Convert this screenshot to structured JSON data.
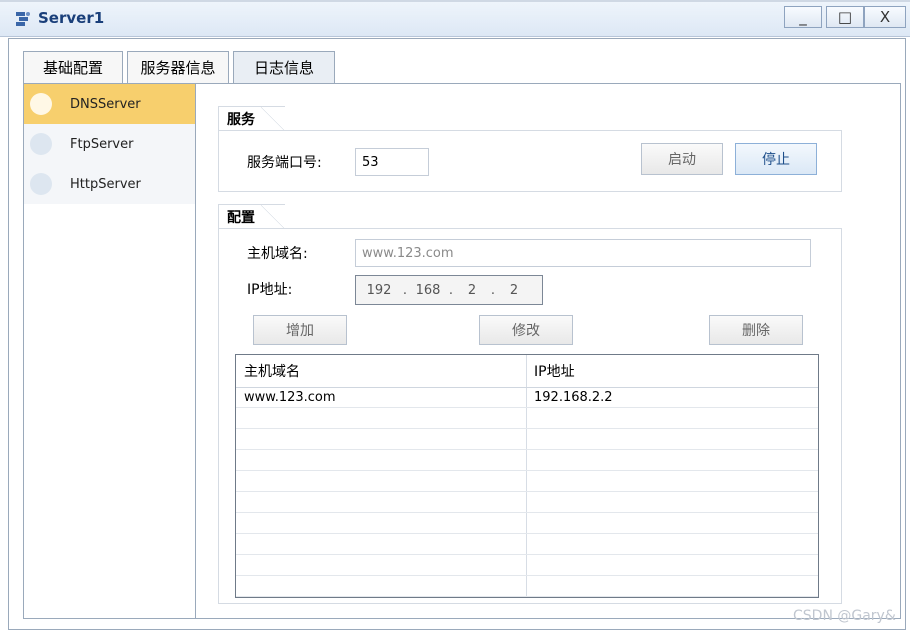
{
  "window": {
    "title": "Server1",
    "min_symbol": "_",
    "max_symbol": "□",
    "close_symbol": "X"
  },
  "tabs": [
    {
      "label": "基础配置"
    },
    {
      "label": "服务器信息"
    },
    {
      "label": "日志信息"
    }
  ],
  "servers": [
    {
      "label": "DNSServer",
      "selected": true
    },
    {
      "label": "FtpServer",
      "selected": false
    },
    {
      "label": "HttpServer",
      "selected": false
    }
  ],
  "service": {
    "group_title": "服务",
    "port_label": "服务端口号:",
    "port_value": "53",
    "start_label": "启动",
    "stop_label": "停止"
  },
  "config": {
    "group_title": "配置",
    "host_label": "主机域名:",
    "host_placeholder": "www.123.com",
    "ip_label": "IP地址:",
    "ip_octets": [
      "192",
      "168",
      "2",
      "2"
    ],
    "add_label": "增加",
    "edit_label": "修改",
    "delete_label": "删除"
  },
  "table": {
    "headers": [
      "主机域名",
      "IP地址"
    ],
    "rows": [
      [
        "www.123.com",
        "192.168.2.2"
      ]
    ]
  },
  "watermark": "CSDN @Gary&",
  "colors": {
    "selected_row": "#f7cf6d",
    "title_text": "#1a3f7a"
  }
}
